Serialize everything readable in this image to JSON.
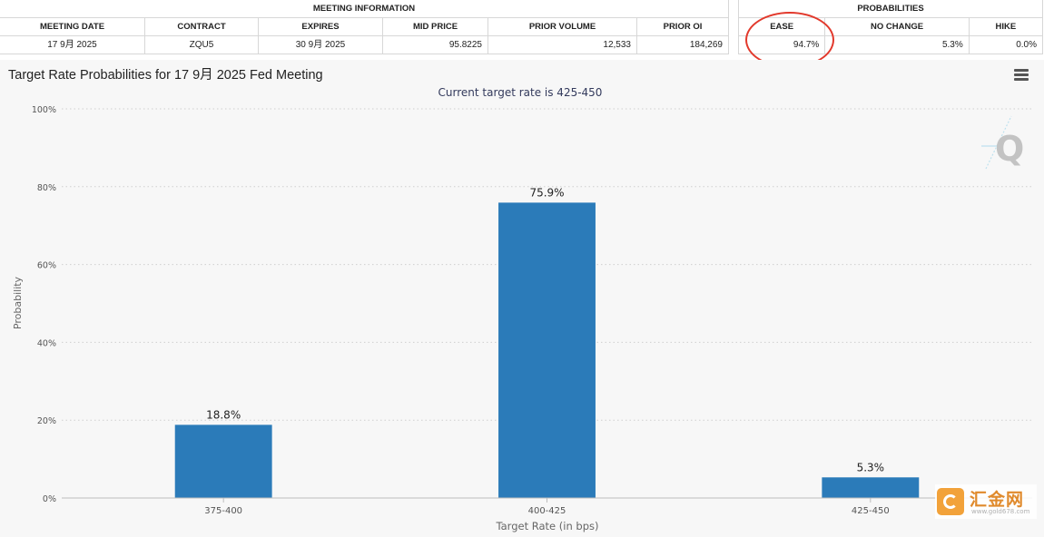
{
  "meeting_info": {
    "group_header": "MEETING INFORMATION",
    "columns": [
      "MEETING DATE",
      "CONTRACT",
      "EXPIRES",
      "MID PRICE",
      "PRIOR VOLUME",
      "PRIOR OI"
    ],
    "row": [
      "17 9月 2025",
      "ZQU5",
      "30 9月 2025",
      "95.8225",
      "12,533",
      "184,269"
    ]
  },
  "probabilities": {
    "group_header": "PROBABILITIES",
    "columns": [
      "EASE",
      "NO CHANGE",
      "HIKE"
    ],
    "row": [
      "94.7%",
      "5.3%",
      "0.0%"
    ],
    "highlight_color": "#e2392c"
  },
  "chart": {
    "title": "Target Rate Probabilities for 17 9月 2025 Fed Meeting",
    "menu_icon": "hamburger-menu-icon",
    "logo_icon": "q-logo-icon"
  },
  "chart_data": {
    "type": "bar",
    "title": "Target Rate Probabilities for 17 9月 2025 Fed Meeting",
    "subtitle": "Current target rate is 425-450",
    "xlabel": "Target Rate (in bps)",
    "ylabel": "Probability",
    "categories": [
      "375-400",
      "400-425",
      "425-450"
    ],
    "values": [
      18.8,
      75.9,
      5.3
    ],
    "data_labels": [
      "18.8%",
      "75.9%",
      "5.3%"
    ],
    "ylim": [
      0,
      100
    ],
    "yticks": [
      0,
      20,
      40,
      60,
      80,
      100
    ],
    "ytick_labels": [
      "0%",
      "20%",
      "40%",
      "60%",
      "80%",
      "100%"
    ],
    "grid": true,
    "bar_color": "#2b7bb9"
  },
  "watermark": {
    "text": "汇金网",
    "url": "www.gold678.com",
    "icon": "gold678-logo-icon"
  }
}
